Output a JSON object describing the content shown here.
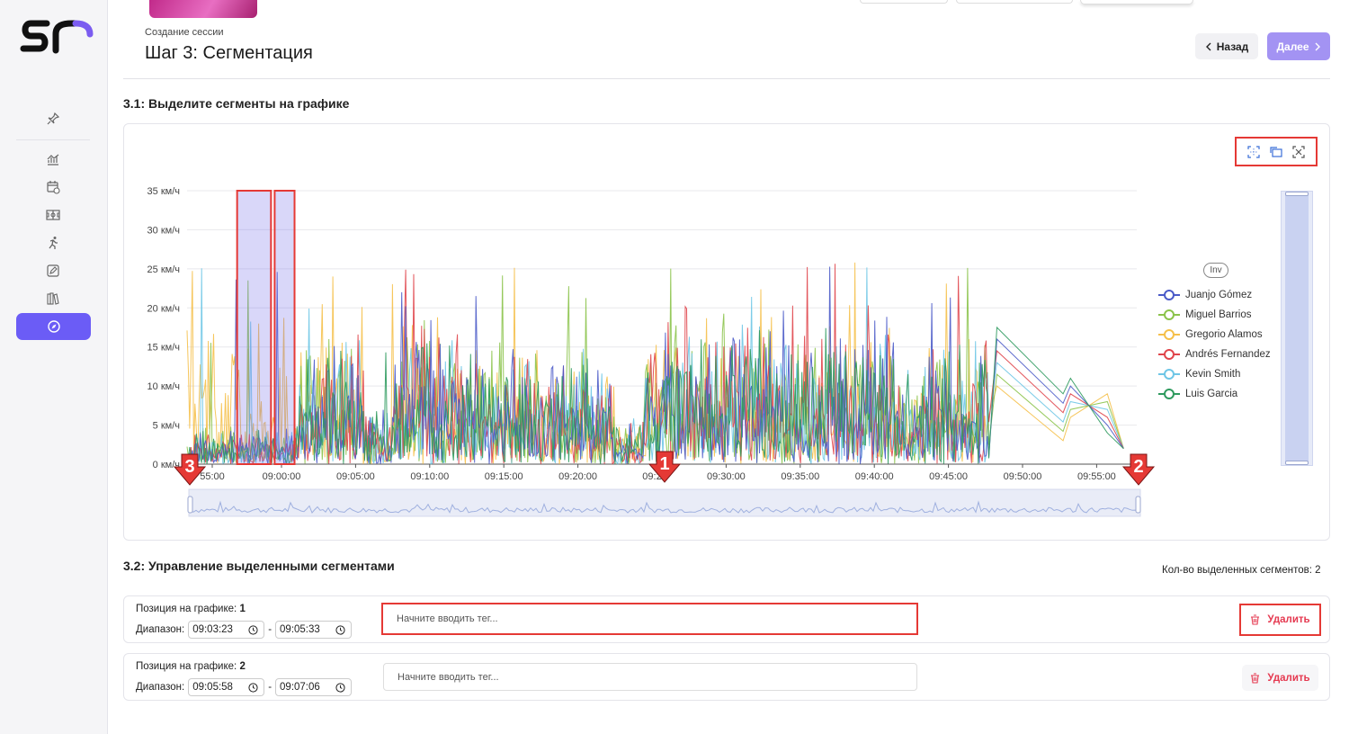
{
  "header": {
    "subtitle": "Создание сессии",
    "title": "Шаг 3: Сегментация",
    "back_label": "Назад",
    "next_label": "Далее"
  },
  "sections": {
    "chart_title": "3.1: Выделите сегменты на графике",
    "manage_title": "3.2: Управление выделенными сегментами"
  },
  "legend": {
    "inv_label": "Inv",
    "items": [
      {
        "name": "Juanjo Gómez",
        "color": "#4a5ac8"
      },
      {
        "name": "Miguel Barrios",
        "color": "#8bc34a"
      },
      {
        "name": "Gregorio Alamos",
        "color": "#f5c04a"
      },
      {
        "name": "Andrés Fernandez",
        "color": "#e0454b"
      },
      {
        "name": "Kevin Smith",
        "color": "#6ec6e6"
      },
      {
        "name": "Luis Garcia",
        "color": "#2e9a5e"
      }
    ]
  },
  "chart_data": {
    "type": "line",
    "ylim": [
      0,
      35
    ],
    "y_ticks": [
      "0 км/ч",
      "5 км/ч",
      "10 км/ч",
      "15 км/ч",
      "20 км/ч",
      "25 км/ч",
      "30 км/ч",
      "35 км/ч"
    ],
    "x_ticks": [
      "08:55:00",
      "09:00:00",
      "09:05:00",
      "09:10:00",
      "09:15:00",
      "09:20:00",
      "09:25:00",
      "09:30:00",
      "09:35:00",
      "09:40:00",
      "09:45:00",
      "09:50:00",
      "09:55:00"
    ],
    "x_tick_display": [
      "55:00",
      "09:00:00",
      "09:05:00",
      "09:10:00",
      "09:15:00",
      "09:20:00",
      "09:2",
      "09:30:00",
      "09:35:00",
      "09:40:00",
      "09:45:00",
      "09:50:00",
      "09:55:00"
    ],
    "xlim_minutes": [
      0,
      64.5
    ],
    "selected_segments_minutes": [
      [
        3.4,
        5.7
      ],
      [
        5.95,
        7.3
      ]
    ],
    "grid": true,
    "legend_position": "right"
  },
  "segments": {
    "count_label": "Кол-во выделенных сегментов: 2",
    "position_label": "Позиция на графике:",
    "range_label": "Диапазон:",
    "placeholder": "Начните вводить тег...",
    "delete_label": "Удалить",
    "items": [
      {
        "position": "1",
        "from": "09:03:23",
        "to": "09:05:33"
      },
      {
        "position": "2",
        "from": "09:05:58",
        "to": "09:07:06"
      }
    ]
  },
  "markers": [
    "1",
    "2",
    "3"
  ],
  "colors": {
    "accent": "#6b5cf6",
    "next_button": "#a393f3",
    "highlight": "#e53935",
    "delete_text": "#e53950"
  },
  "icons": {
    "sidebar": [
      "pin-icon",
      "chart-icon",
      "calendar-icon",
      "field-icon",
      "runner-icon",
      "edit-icon",
      "books-icon",
      "compass-icon"
    ],
    "toolbox": [
      "zoom-select-icon",
      "zoom-back-icon",
      "clear-selection-icon"
    ]
  }
}
